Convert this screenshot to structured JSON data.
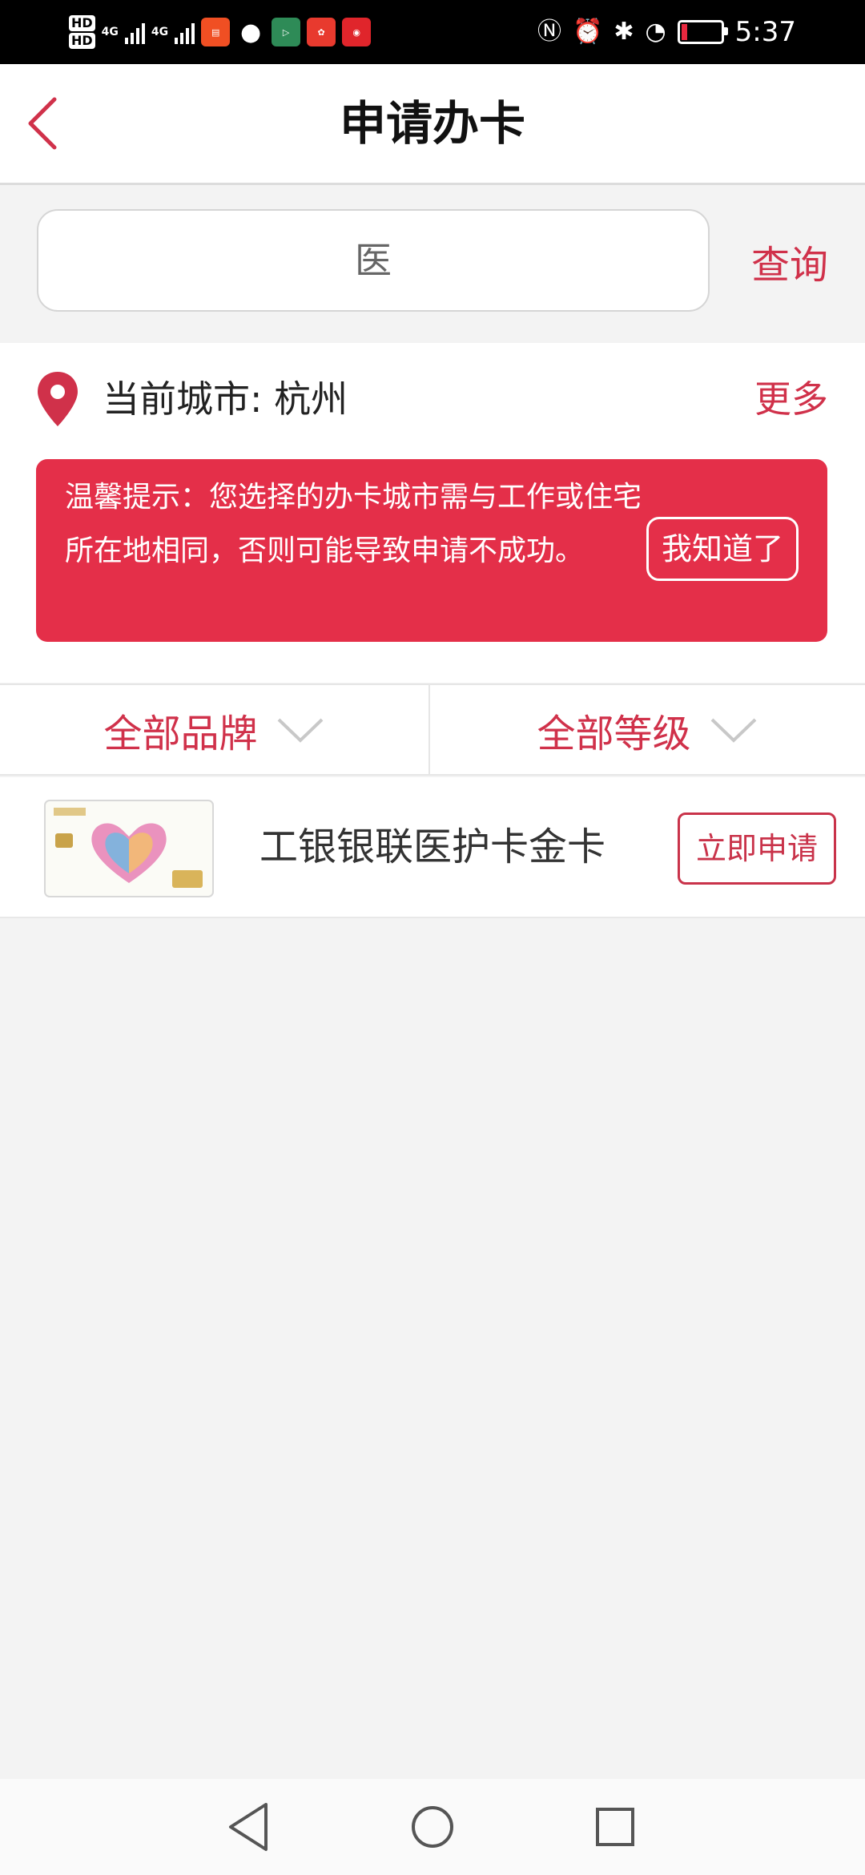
{
  "status_bar": {
    "time": "5:37",
    "network_1": "4G",
    "network_2": "4G",
    "hd_1": "HD",
    "hd_2": "HD",
    "app_icons": [
      "news-app-icon",
      "chat-bubble-icon",
      "play-app-icon",
      "red-app-icon",
      "weibo-icon"
    ],
    "right_icons": [
      "nfc-icon",
      "alarm-icon",
      "bluetooth-icon",
      "speed-icon",
      "battery-icon"
    ],
    "battery_level": 0.15
  },
  "header": {
    "title": "申请办卡",
    "back_icon": "chevron-left-icon"
  },
  "search": {
    "value": "医",
    "button_label": "查询"
  },
  "city": {
    "label": "当前城市: 杭州",
    "more_label": "更多"
  },
  "notice": {
    "text": "温馨提示：您选择的办卡城市需与工作或住宅所在地相同，否则可能导致申请不成功。",
    "button_label": "我知道了"
  },
  "filters": [
    {
      "label": "全部品牌"
    },
    {
      "label": "全部等级"
    }
  ],
  "cards": [
    {
      "name": "工银银联医护卡金卡",
      "apply_label": "立即申请"
    }
  ],
  "colors": {
    "accent": "#d0314a",
    "notice_bg": "#e42f49",
    "page_bg": "#f3f3f3"
  }
}
